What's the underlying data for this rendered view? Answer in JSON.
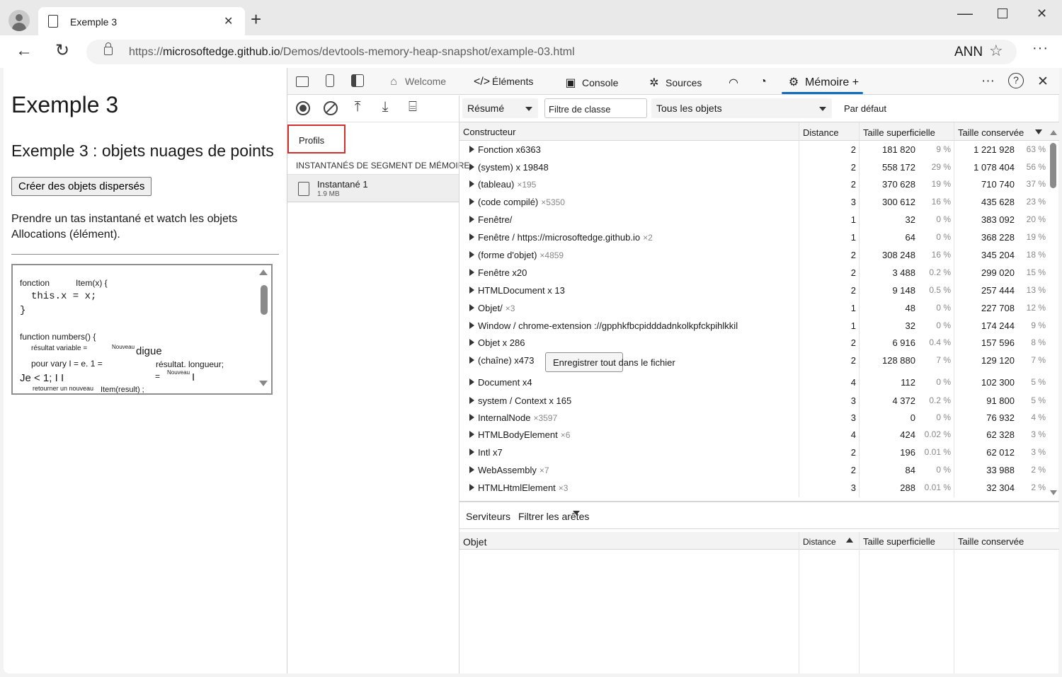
{
  "browser": {
    "tab_title": "Exemple 3",
    "url_prefix": "https://",
    "url_host": "microsoftedge.github.io",
    "url_path": "/Demos/devtools-memory-heap-snapshot/example-03.html",
    "profile_label": "ANN"
  },
  "page": {
    "title": "Exemple 3",
    "subtitle": "Exemple 3 : objets nuages de points",
    "button_label": "Créer des objets dispersés",
    "description": "Prendre un tas instantané et watch les objets Allocations (élément).",
    "code": {
      "l1a": "fonction",
      "l1b": "Item(x) {",
      "l2": "this.x = x;",
      "l3": "}",
      "l4": "function numbers() {",
      "l5a": "résultat variable =",
      "l5b": "Nouveau",
      "l5c": "digue",
      "l6a": "pour vary I = e. 1 =",
      "l6b": "résultat. longueur;",
      "l7a": "Je < 1; I I",
      "l7b": "=",
      "l7c": "Nouveau",
      "l7d": "I",
      "l8a": "retourner un nouveau",
      "l8b": "Item(result) ;"
    }
  },
  "devtools": {
    "tabs": {
      "welcome": "Welcome",
      "elements": "Éléments",
      "console": "Console",
      "sources": "Sources",
      "memory": "Mémoire",
      "memory_plus": "+"
    },
    "profiles_label": "Profils",
    "heap_header": "INSTANTANÉS DE SEGMENT DE MÉMOIRE",
    "snapshot": {
      "name": "Instantané 1",
      "size": "1.9 MB"
    },
    "view_select": "Résumé",
    "class_filter_placeholder": "Filtre de classe",
    "objects_select": "Tous les objets",
    "default_label": "Par défaut",
    "columns": {
      "constructor": "Constructeur",
      "distance": "Distance",
      "shallow": "Taille superficielle",
      "retained": "Taille conservée"
    },
    "rows": [
      {
        "name": "Fonction x6363",
        "count": "",
        "distance": "2",
        "shallow": "181 820",
        "spct": "9 %",
        "retained": "1 221 928",
        "rpct": "63 %"
      },
      {
        "name": "(system) x 19848",
        "count": "",
        "distance": "2",
        "shallow": "558 172",
        "spct": "29 %",
        "retained": "1 078 404",
        "rpct": "56 %"
      },
      {
        "name": "(tableau)",
        "count": "×195",
        "distance": "2",
        "shallow": "370 628",
        "spct": "19 %",
        "retained": "710 740",
        "rpct": "37 %"
      },
      {
        "name": "(code compilé)",
        "count": "×5350",
        "distance": "3",
        "shallow": "300 612",
        "spct": "16 %",
        "retained": "435 628",
        "rpct": "23 %"
      },
      {
        "name": "Fenêtre/",
        "count": "",
        "distance": "1",
        "shallow": "32",
        "spct": "0 %",
        "retained": "383 092",
        "rpct": "20 %"
      },
      {
        "name": "Fenêtre / https://microsoftedge.github.io",
        "count": "×2",
        "distance": "1",
        "shallow": "64",
        "spct": "0 %",
        "retained": "368 228",
        "rpct": "19 %"
      },
      {
        "name": "(forme d'objet)",
        "count": "×4859",
        "distance": "2",
        "shallow": "308 248",
        "spct": "16 %",
        "retained": "345 204",
        "rpct": "18 %"
      },
      {
        "name": "Fenêtre x20",
        "count": "",
        "distance": "2",
        "shallow": "3 488",
        "spct": "0.2 %",
        "retained": "299 020",
        "rpct": "15 %"
      },
      {
        "name": "HTMLDocument x 13",
        "count": "",
        "distance": "2",
        "shallow": "9 148",
        "spct": "0.5 %",
        "retained": "257 444",
        "rpct": "13 %"
      },
      {
        "name": "Objet/",
        "count": "×3",
        "distance": "1",
        "shallow": "48",
        "spct": "0 %",
        "retained": "227 708",
        "rpct": "12 %"
      },
      {
        "name": "Window / chrome-extension ://gpphkfbcpidddadnkolkpfckpihlkkil",
        "count": "",
        "distance": "1",
        "shallow": "32",
        "spct": "0 %",
        "retained": "174 244",
        "rpct": "9 %"
      },
      {
        "name": "Objet x 286",
        "count": "",
        "distance": "2",
        "shallow": "6 916",
        "spct": "0.4 %",
        "retained": "157 596",
        "rpct": "8 %"
      },
      {
        "name": "(chaîne) x473",
        "count": "",
        "distance": "2",
        "shallow": "128 880",
        "spct": "7 %",
        "retained": "129 120",
        "rpct": "7 %"
      },
      {
        "name": "Document x4",
        "count": "",
        "distance": "4",
        "shallow": "112",
        "spct": "0 %",
        "retained": "102 300",
        "rpct": "5 %"
      },
      {
        "name": "system / Context x 165",
        "count": "",
        "distance": "3",
        "shallow": "4 372",
        "spct": "0.2 %",
        "retained": "91 800",
        "rpct": "5 %"
      },
      {
        "name": "InternalNode",
        "count": "×3597",
        "distance": "3",
        "shallow": "0",
        "spct": "0 %",
        "retained": "76 932",
        "rpct": "4 %"
      },
      {
        "name": "HTMLBodyElement",
        "count": "×6",
        "distance": "4",
        "shallow": "424",
        "spct": "0.02 %",
        "retained": "62 328",
        "rpct": "3 %"
      },
      {
        "name": "Intl x7",
        "count": "",
        "distance": "2",
        "shallow": "196",
        "spct": "0.01 %",
        "retained": "62 012",
        "rpct": "3 %"
      },
      {
        "name": "WebAssembly",
        "count": "×7",
        "distance": "2",
        "shallow": "84",
        "spct": "0 %",
        "retained": "33 988",
        "rpct": "2 %"
      },
      {
        "name": "HTMLHtmlElement",
        "count": "×3",
        "distance": "3",
        "shallow": "288",
        "spct": "0.01 %",
        "retained": "32 304",
        "rpct": "2 %"
      }
    ],
    "save_button": "Enregistrer tout dans le fichier",
    "retainers": {
      "label": "Serviteurs",
      "filter": "Filtrer les arêtes",
      "columns": {
        "object": "Objet",
        "distance": "Distance",
        "shallow": "Taille superficielle",
        "retained": "Taille conservée"
      }
    }
  }
}
